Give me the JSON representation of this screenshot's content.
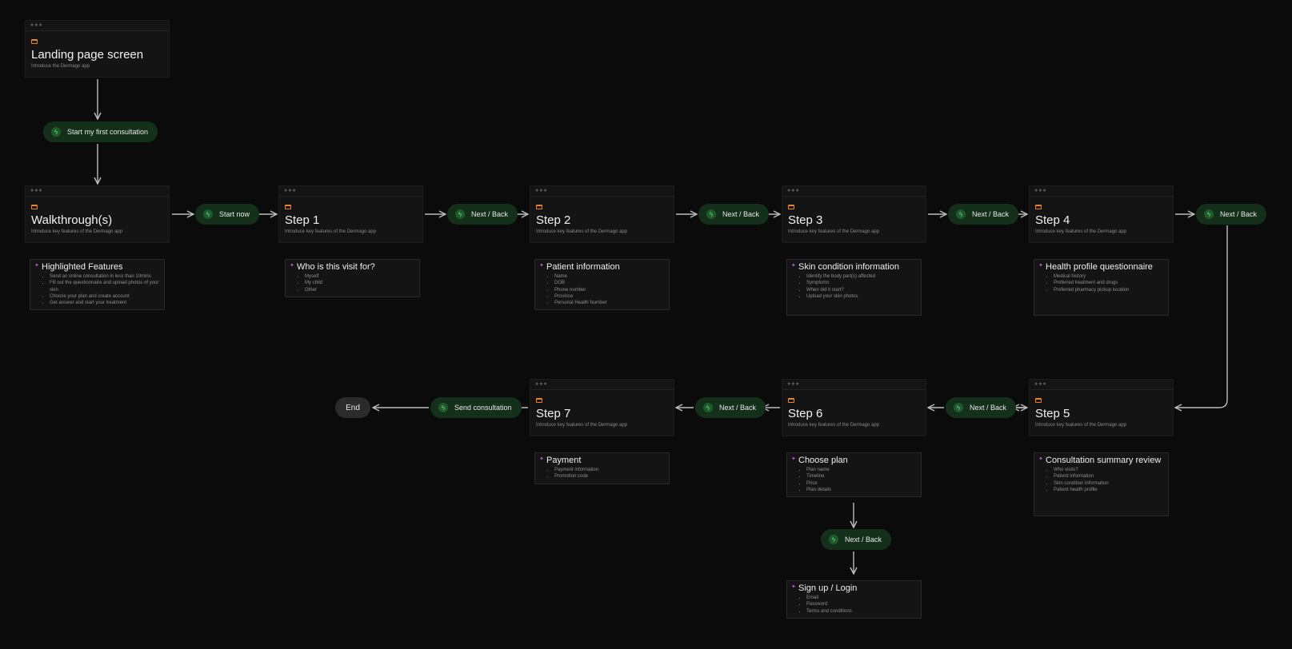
{
  "colors": {
    "background": "#0b0b0b",
    "card": "#141414",
    "pill": "#14301a",
    "pill_icon": "#6ee08a",
    "screen_icon": "#e8832a",
    "note_icon": "#c05ad8",
    "connector": "#bdbdbd"
  },
  "icons": {
    "screen": "browser-window-icon",
    "note": "sparkle-icon",
    "action": "lightning-icon"
  },
  "screens": {
    "landing": {
      "title": "Landing page screen",
      "subtitle": "Introduce the Dermago app"
    },
    "walkthrough": {
      "title": "Walkthrough(s)",
      "subtitle": "Introduce key features of the Dermago app"
    },
    "step1": {
      "title": "Step 1",
      "subtitle": "Introduce key features of the Dermago app"
    },
    "step2": {
      "title": "Step 2",
      "subtitle": "Introduce key features of the Dermago app"
    },
    "step3": {
      "title": "Step 3",
      "subtitle": "Introduce key features of the Dermago app"
    },
    "step4": {
      "title": "Step 4",
      "subtitle": "Introduce key features of the Dermago app"
    },
    "step5": {
      "title": "Step 5",
      "subtitle": "Introduce key features of the Dermago app"
    },
    "step6": {
      "title": "Step 6",
      "subtitle": "Introduce key features of the Dermago app"
    },
    "step7": {
      "title": "Step 7",
      "subtitle": "Introduce key features of the Dermago app"
    }
  },
  "notes": {
    "highlighted": {
      "title": "Highlighted Features",
      "items": [
        "Send an online consultation in less than 10mins",
        "Fill out the questionnaire and upload photos of your skin",
        "Choose your plan and create account",
        "Get answer and start your treatment"
      ]
    },
    "who": {
      "title": "Who is this visit for?",
      "items": [
        "Myself",
        "My child",
        "Other"
      ]
    },
    "patient": {
      "title": "Patient information",
      "items": [
        "Name",
        "DOB",
        "Phone number",
        "Province",
        "Personal Health Number"
      ]
    },
    "skin": {
      "title": "Skin condition information",
      "items": [
        "Identify the body part(s) affected",
        "Symptoms",
        "When did it start?",
        "Upload your skin photos"
      ]
    },
    "health": {
      "title": "Health profile questionnaire",
      "items": [
        "Medical history",
        "Preferred treatment and drugs",
        "Preferred pharmacy pickup location"
      ]
    },
    "summary": {
      "title": "Consultation summary review",
      "items": [
        "Who visits?",
        "Patient information",
        "Skin condition information",
        "Patient health profile"
      ]
    },
    "plan": {
      "title": "Choose plan",
      "items": [
        "Plan name",
        "Timeline",
        "Price",
        "Plan details"
      ]
    },
    "payment": {
      "title": "Payment",
      "items": [
        "Payment information",
        "Promotion code"
      ]
    },
    "signup": {
      "title": "Sign up / Login",
      "items": [
        "Email",
        "Password",
        "Terms and conditions"
      ]
    }
  },
  "actions": {
    "start_consult": "Start my first consultation",
    "start_now": "Start now",
    "next_1": "Next / Back",
    "next_2": "Next / Back",
    "next_3": "Next / Back",
    "next_4": "Next / Back",
    "next_5": "Next / Back",
    "next_6": "Next / Back",
    "next_7": "Next / Back",
    "send": "Send consultation",
    "end": "End"
  }
}
